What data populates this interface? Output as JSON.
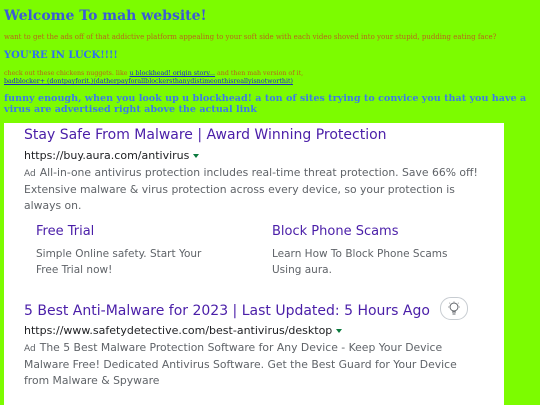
{
  "page": {
    "title": "Welcome To mah website!",
    "intro": "want to get the ads off of that addictive platform appealing to your soft side with each video shoved into your stupid, pudding eating face?",
    "luck": "YOU'RE IN LUCK!!!!",
    "nuggets_prefix": "check out these chickens nuggets. like ",
    "nuggets_link1": "u blockhead! origin story...",
    "nuggets_mid": " and then mah version of it,",
    "nuggets_link2": "badblocker+ (dontpayforit.)(datherpayforallblockersthanydistimeonthisreallyisnotworthit)",
    "funny": "funny enough, when you look up u blockhead! a ton of sites trying to convice you that you have a virus are advertised right above the actual link"
  },
  "results": {
    "ad1": {
      "title": "Stay Safe From Malware | Award Winning Protection",
      "url": "https://buy.aura.com/antivirus",
      "badge": "Ad",
      "desc": "All-in-one antivirus protection includes real-time threat protection. Save 66% off! Extensive malware & virus protection across every device, so your protection is always on.",
      "sitelinks": [
        {
          "title": "Free Trial",
          "desc": "Simple Online safety. Start Your Free Trial now!"
        },
        {
          "title": "Block Phone Scams",
          "desc": "Learn How To Block Phone Scams Using aura."
        }
      ]
    },
    "ad2": {
      "title": "5 Best Anti-Malware for 2023 | Last Updated: 5 Hours Ago",
      "url": "https://www.safetydetective.com/best-antivirus/desktop",
      "badge": "Ad",
      "desc": "The 5 Best Malware Protection Software for Any Device - Keep Your Device Malware Free! Dedicated Antivirus Software. Get the Best Guard for Your Device from Malware & Spyware"
    }
  }
}
